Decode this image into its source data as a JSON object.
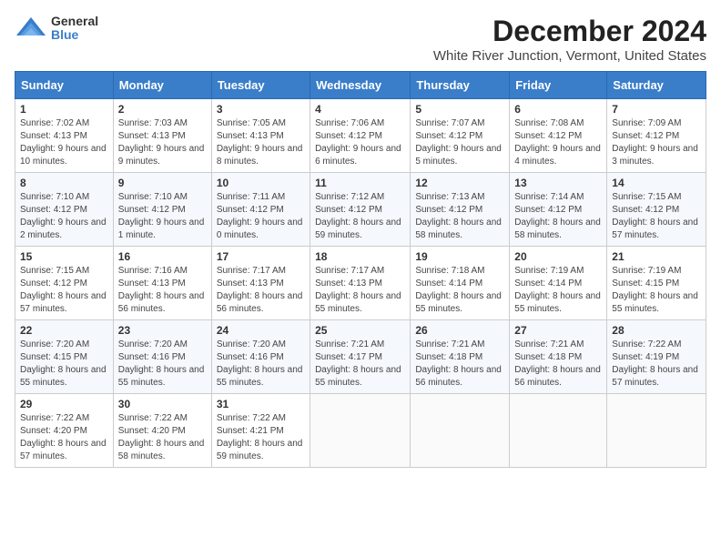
{
  "logo": {
    "general": "General",
    "blue": "Blue"
  },
  "title": "December 2024",
  "location": "White River Junction, Vermont, United States",
  "days_of_week": [
    "Sunday",
    "Monday",
    "Tuesday",
    "Wednesday",
    "Thursday",
    "Friday",
    "Saturday"
  ],
  "weeks": [
    [
      {
        "day": 1,
        "sunrise": "7:02 AM",
        "sunset": "4:13 PM",
        "daylight": "9 hours and 10 minutes."
      },
      {
        "day": 2,
        "sunrise": "7:03 AM",
        "sunset": "4:13 PM",
        "daylight": "9 hours and 9 minutes."
      },
      {
        "day": 3,
        "sunrise": "7:05 AM",
        "sunset": "4:13 PM",
        "daylight": "9 hours and 8 minutes."
      },
      {
        "day": 4,
        "sunrise": "7:06 AM",
        "sunset": "4:12 PM",
        "daylight": "9 hours and 6 minutes."
      },
      {
        "day": 5,
        "sunrise": "7:07 AM",
        "sunset": "4:12 PM",
        "daylight": "9 hours and 5 minutes."
      },
      {
        "day": 6,
        "sunrise": "7:08 AM",
        "sunset": "4:12 PM",
        "daylight": "9 hours and 4 minutes."
      },
      {
        "day": 7,
        "sunrise": "7:09 AM",
        "sunset": "4:12 PM",
        "daylight": "9 hours and 3 minutes."
      }
    ],
    [
      {
        "day": 8,
        "sunrise": "7:10 AM",
        "sunset": "4:12 PM",
        "daylight": "9 hours and 2 minutes."
      },
      {
        "day": 9,
        "sunrise": "7:10 AM",
        "sunset": "4:12 PM",
        "daylight": "9 hours and 1 minute."
      },
      {
        "day": 10,
        "sunrise": "7:11 AM",
        "sunset": "4:12 PM",
        "daylight": "9 hours and 0 minutes."
      },
      {
        "day": 11,
        "sunrise": "7:12 AM",
        "sunset": "4:12 PM",
        "daylight": "8 hours and 59 minutes."
      },
      {
        "day": 12,
        "sunrise": "7:13 AM",
        "sunset": "4:12 PM",
        "daylight": "8 hours and 58 minutes."
      },
      {
        "day": 13,
        "sunrise": "7:14 AM",
        "sunset": "4:12 PM",
        "daylight": "8 hours and 58 minutes."
      },
      {
        "day": 14,
        "sunrise": "7:15 AM",
        "sunset": "4:12 PM",
        "daylight": "8 hours and 57 minutes."
      }
    ],
    [
      {
        "day": 15,
        "sunrise": "7:15 AM",
        "sunset": "4:12 PM",
        "daylight": "8 hours and 57 minutes."
      },
      {
        "day": 16,
        "sunrise": "7:16 AM",
        "sunset": "4:13 PM",
        "daylight": "8 hours and 56 minutes."
      },
      {
        "day": 17,
        "sunrise": "7:17 AM",
        "sunset": "4:13 PM",
        "daylight": "8 hours and 56 minutes."
      },
      {
        "day": 18,
        "sunrise": "7:17 AM",
        "sunset": "4:13 PM",
        "daylight": "8 hours and 55 minutes."
      },
      {
        "day": 19,
        "sunrise": "7:18 AM",
        "sunset": "4:14 PM",
        "daylight": "8 hours and 55 minutes."
      },
      {
        "day": 20,
        "sunrise": "7:19 AM",
        "sunset": "4:14 PM",
        "daylight": "8 hours and 55 minutes."
      },
      {
        "day": 21,
        "sunrise": "7:19 AM",
        "sunset": "4:15 PM",
        "daylight": "8 hours and 55 minutes."
      }
    ],
    [
      {
        "day": 22,
        "sunrise": "7:20 AM",
        "sunset": "4:15 PM",
        "daylight": "8 hours and 55 minutes."
      },
      {
        "day": 23,
        "sunrise": "7:20 AM",
        "sunset": "4:16 PM",
        "daylight": "8 hours and 55 minutes."
      },
      {
        "day": 24,
        "sunrise": "7:20 AM",
        "sunset": "4:16 PM",
        "daylight": "8 hours and 55 minutes."
      },
      {
        "day": 25,
        "sunrise": "7:21 AM",
        "sunset": "4:17 PM",
        "daylight": "8 hours and 55 minutes."
      },
      {
        "day": 26,
        "sunrise": "7:21 AM",
        "sunset": "4:18 PM",
        "daylight": "8 hours and 56 minutes."
      },
      {
        "day": 27,
        "sunrise": "7:21 AM",
        "sunset": "4:18 PM",
        "daylight": "8 hours and 56 minutes."
      },
      {
        "day": 28,
        "sunrise": "7:22 AM",
        "sunset": "4:19 PM",
        "daylight": "8 hours and 57 minutes."
      }
    ],
    [
      {
        "day": 29,
        "sunrise": "7:22 AM",
        "sunset": "4:20 PM",
        "daylight": "8 hours and 57 minutes."
      },
      {
        "day": 30,
        "sunrise": "7:22 AM",
        "sunset": "4:20 PM",
        "daylight": "8 hours and 58 minutes."
      },
      {
        "day": 31,
        "sunrise": "7:22 AM",
        "sunset": "4:21 PM",
        "daylight": "8 hours and 59 minutes."
      },
      null,
      null,
      null,
      null
    ]
  ]
}
